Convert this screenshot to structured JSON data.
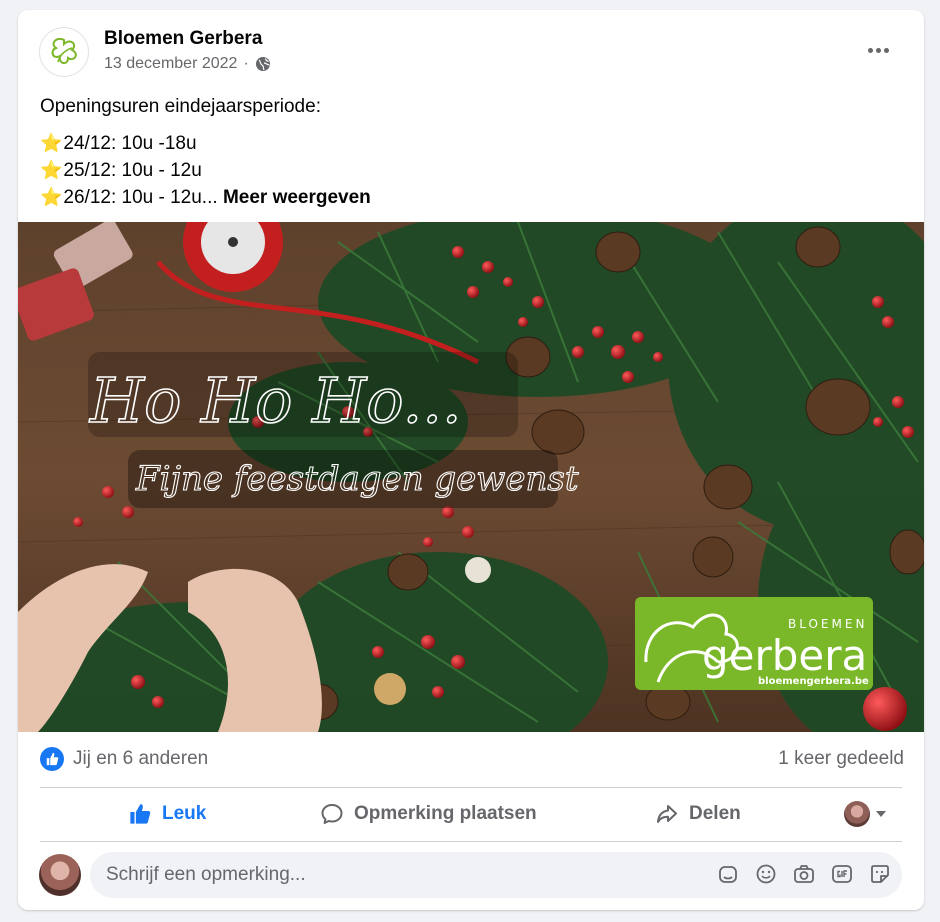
{
  "post": {
    "page_name": "Bloemen Gerbera",
    "date": "13 december 2022",
    "separator": "·",
    "text_intro": "Openingsuren eindejaarsperiode:",
    "lines": [
      {
        "star": "⭐",
        "text": "24/12: 10u -18u"
      },
      {
        "star": "⭐",
        "text": "25/12: 10u - 12u"
      },
      {
        "star": "⭐",
        "text": "26/12: 10u - 12u..."
      }
    ],
    "see_more": "Meer weergeven"
  },
  "image": {
    "headline": "Ho Ho Ho...",
    "subline": "Fijne feestdagen gewenst",
    "logo_top": "BLOEMEN",
    "logo_main": "gerbera",
    "logo_url": "bloemengerbera.be",
    "logo_color": "#7ab829"
  },
  "reactions": {
    "likes_text": "Jij en 6 anderen",
    "shares_text": "1 keer gedeeld"
  },
  "actions": {
    "like": "Leuk",
    "comment": "Opmerking plaatsen",
    "share": "Delen"
  },
  "comment": {
    "placeholder": "Schrijf een opmerking..."
  },
  "colors": {
    "accent": "#1877f2",
    "muted": "#65676b"
  }
}
